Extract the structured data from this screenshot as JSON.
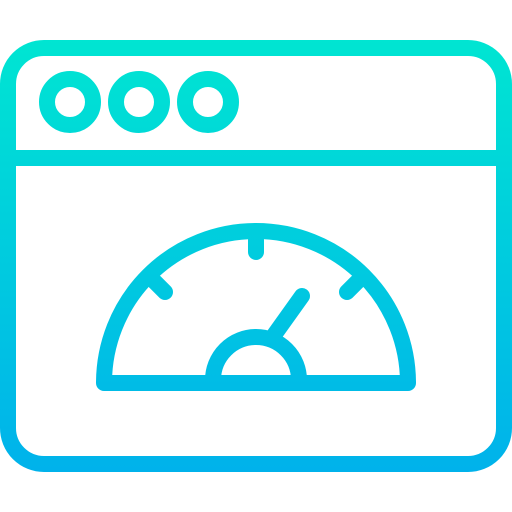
{
  "icon": {
    "name": "browser-speedometer-icon",
    "gradient_top": "#00E5D2",
    "gradient_bottom": "#00B2EB",
    "window_control_icons": [
      "window-dot-icon",
      "window-dot-icon",
      "window-dot-icon"
    ],
    "gauge_icon": "speedometer-icon",
    "gauge_level": 0.69
  }
}
